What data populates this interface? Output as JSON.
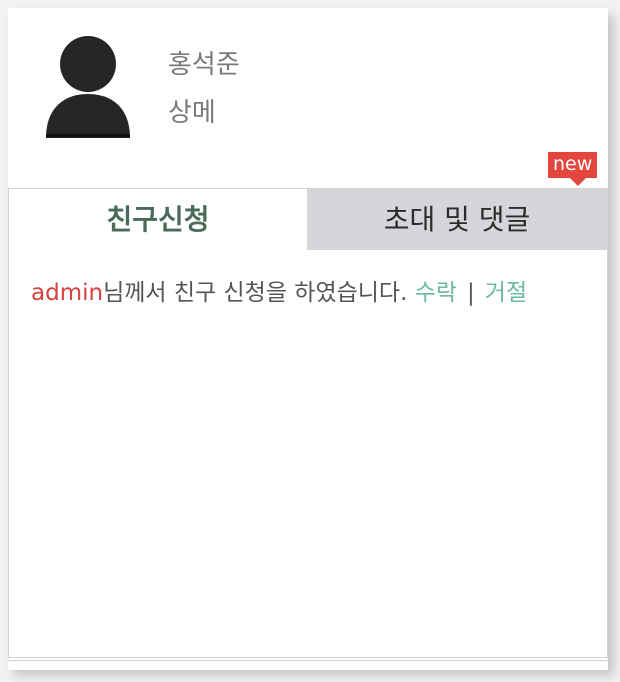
{
  "profile": {
    "name": "홍석준",
    "rank": "상메"
  },
  "badge": {
    "label": "new"
  },
  "tabs": [
    {
      "label": "친구신청",
      "active": true
    },
    {
      "label": "초대 및 댓글",
      "active": false
    }
  ],
  "notification": {
    "user": "admin",
    "text": "님께서 친구 신청을 하였습니다.",
    "accept_label": "수락",
    "separator": "|",
    "reject_label": "거절"
  },
  "colors": {
    "user_name": "#d64141",
    "action_link": "#6fb9a4",
    "active_tab_text": "#4a6b5a",
    "inactive_tab_bg": "#d4d6d9",
    "badge_bg": "#e2463e"
  }
}
